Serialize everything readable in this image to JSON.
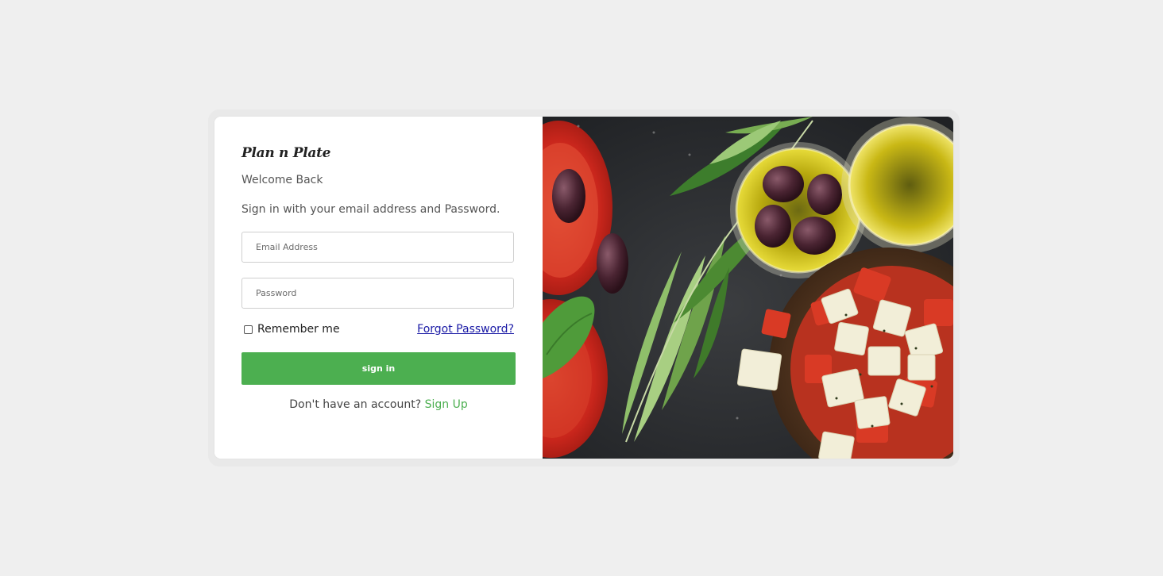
{
  "app": {
    "logo_text": "Plan n Plate"
  },
  "login": {
    "welcome": "Welcome Back",
    "subtitle": "Sign in with your email address and Password.",
    "email_placeholder": "Email Address",
    "password_placeholder": "Password",
    "remember_label": "Remember me",
    "forgot_label": "Forgot Password?",
    "signin_label": "sign in",
    "no_account_text": "Don't have an account?",
    "signup_label": "Sign Up"
  },
  "colors": {
    "accent": "#4caf50",
    "page_background": "#efefef",
    "link": "#1a1aa6"
  },
  "hero": {
    "icon": "food-photo-icon"
  }
}
